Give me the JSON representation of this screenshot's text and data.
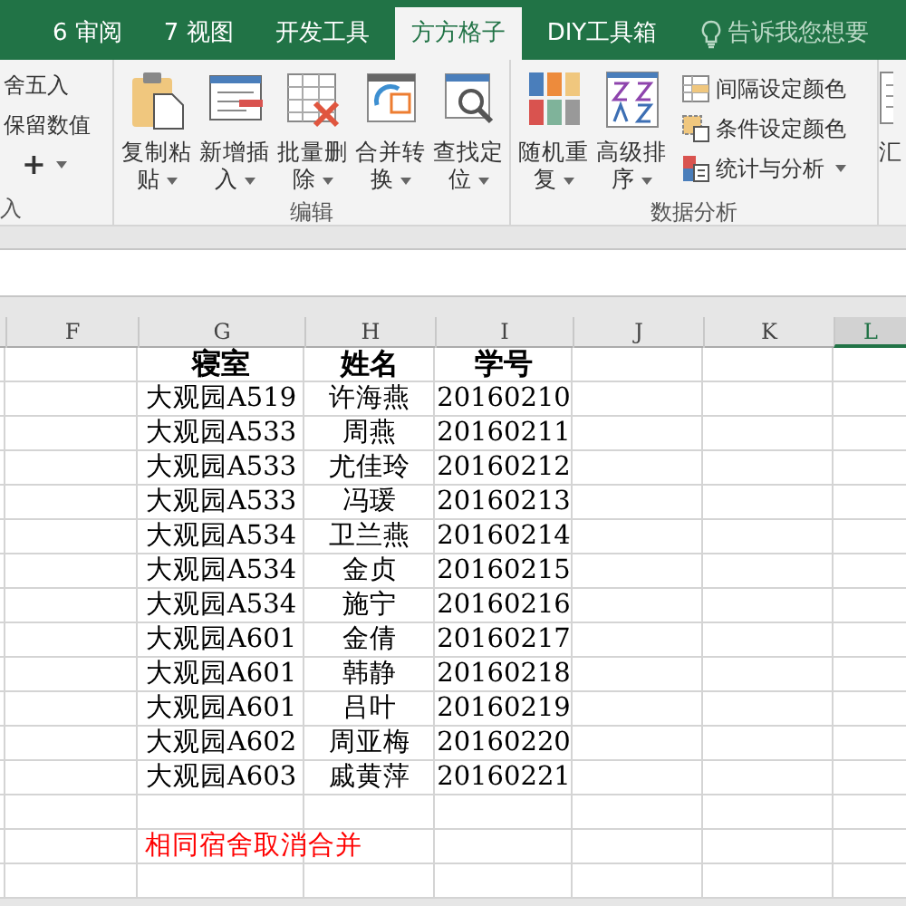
{
  "ribbon_tabs": [
    {
      "label": "6 审阅",
      "selected": false
    },
    {
      "label": "7 视图",
      "selected": false
    },
    {
      "label": "开发工具",
      "selected": false
    },
    {
      "label": "方方格子",
      "selected": true
    },
    {
      "label": "DIY工具箱",
      "selected": false
    }
  ],
  "tell_me": {
    "placeholder": "告诉我您想要"
  },
  "ribbon_groups": [
    {
      "label": "入",
      "items": [
        {
          "kind": "small",
          "label": "舍五入",
          "dropdown": false
        },
        {
          "kind": "small",
          "label": "保留数值",
          "dropdown": false
        },
        {
          "kind": "small",
          "label": "+",
          "dropdown": true
        }
      ]
    },
    {
      "label": "编辑",
      "items": [
        {
          "kind": "large",
          "lines": [
            "复制粘",
            "贴"
          ],
          "dropdown": true
        },
        {
          "kind": "large",
          "lines": [
            "新增插",
            "入"
          ],
          "dropdown": true
        },
        {
          "kind": "large",
          "lines": [
            "批量删",
            "除"
          ],
          "dropdown": true
        },
        {
          "kind": "large",
          "lines": [
            "合并转",
            "换"
          ],
          "dropdown": true
        },
        {
          "kind": "large",
          "lines": [
            "查找定",
            "位"
          ],
          "dropdown": true
        }
      ]
    },
    {
      "label": "数据分析",
      "items": [
        {
          "kind": "large",
          "lines": [
            "随机重",
            "复"
          ],
          "dropdown": true
        },
        {
          "kind": "large",
          "lines": [
            "高级排",
            "序"
          ],
          "dropdown": true
        },
        {
          "kind": "stack",
          "entries": [
            {
              "label": "间隔设定颜色",
              "dropdown": false
            },
            {
              "label": "条件设定颜色",
              "dropdown": false
            },
            {
              "label": "统计与分析",
              "dropdown": true
            }
          ]
        }
      ]
    },
    {
      "items": [
        {
          "kind": "large",
          "lines": [
            "汇"
          ]
        }
      ]
    }
  ],
  "sheet": {
    "columns": [
      {
        "label": "F",
        "selected": false
      },
      {
        "label": "G",
        "selected": false
      },
      {
        "label": "H",
        "selected": false
      },
      {
        "label": "I",
        "selected": false
      },
      {
        "label": "J",
        "selected": false
      },
      {
        "label": "K",
        "selected": false
      },
      {
        "label": "L",
        "selected": true
      }
    ],
    "rows": [
      [
        "",
        "寝室",
        "姓名",
        "学号"
      ],
      [
        "",
        "大观园A519",
        "许海燕",
        "20160210"
      ],
      [
        "",
        "大观园A533",
        "周燕",
        "20160211"
      ],
      [
        "",
        "大观园A533",
        "尤佳玲",
        "20160212"
      ],
      [
        "",
        "大观园A533",
        "冯瑗",
        "20160213"
      ],
      [
        "",
        "大观园A534",
        "卫兰燕",
        "20160214"
      ],
      [
        "",
        "大观园A534",
        "金贞",
        "20160215"
      ],
      [
        "",
        "大观园A534",
        "施宁",
        "20160216"
      ],
      [
        "",
        "大观园A601",
        "金倩",
        "20160217"
      ],
      [
        "",
        "大观园A601",
        "韩静",
        "20160218"
      ],
      [
        "",
        "大观园A601",
        "吕叶",
        "20160219"
      ],
      [
        "",
        "大观园A602",
        "周亚梅",
        "20160220"
      ],
      [
        "",
        "大观园A603",
        "戚黄萍",
        "20160221"
      ]
    ],
    "note": "相同宿舍取消合并"
  }
}
